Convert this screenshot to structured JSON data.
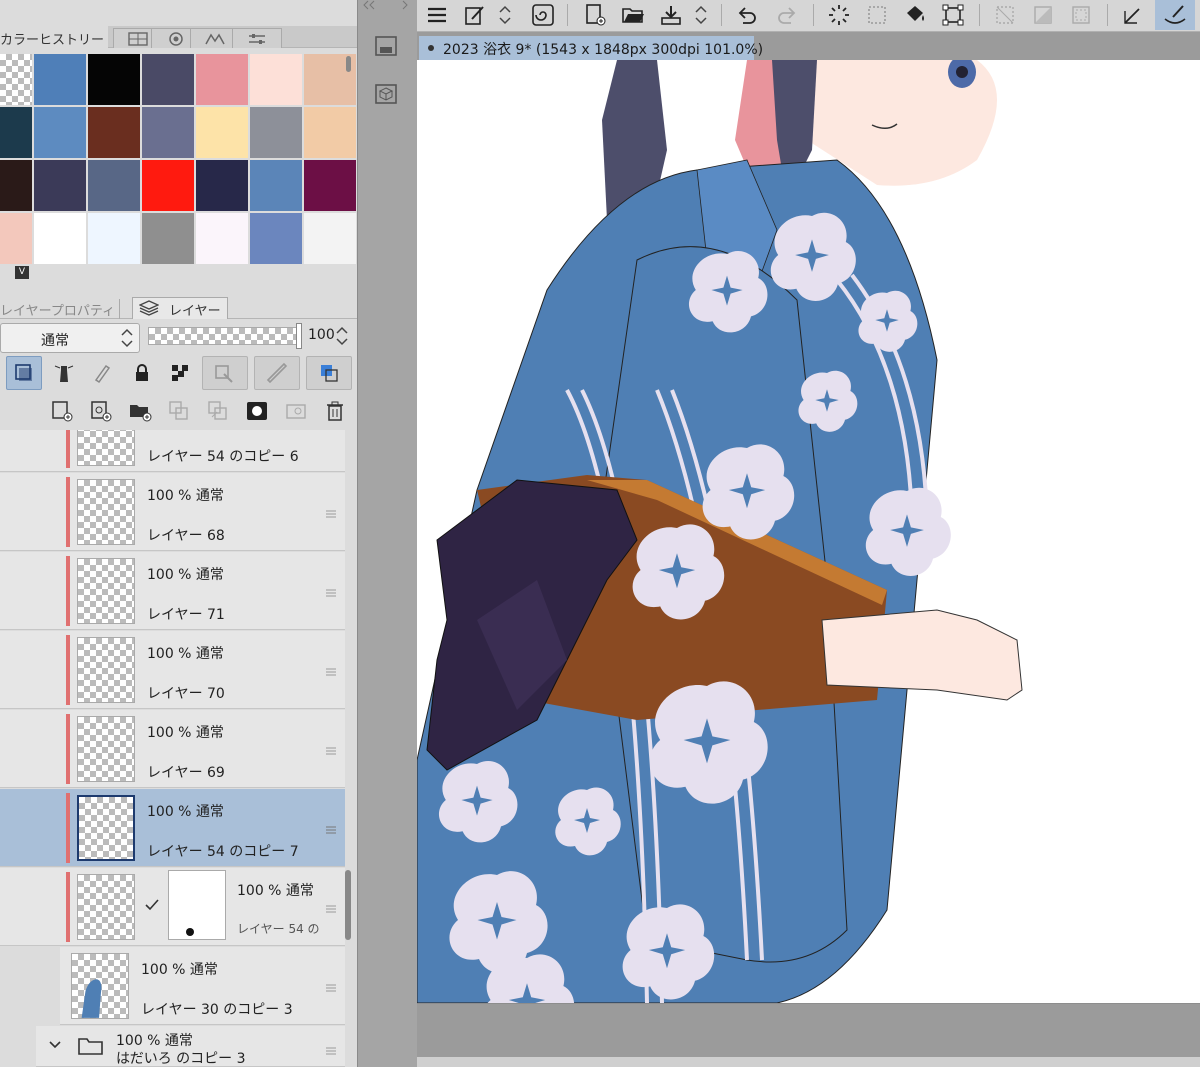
{
  "palette": {
    "tab_label": "カラーヒストリー",
    "tabs": [
      "color-set-icon",
      "color-circle-icon",
      "color-mountain-icon",
      "color-slider-icon"
    ],
    "swatches": [
      [
        "checker",
        "#4f7fb8",
        "#050505",
        "#4a4a66",
        "#e8949c",
        "#fde0d8",
        "#e7bfa6"
      ],
      [
        "#1c3a4c",
        "#5d8bc0",
        "#6a2e1f",
        "#6a6f90",
        "#fde3a8",
        "#8d9099",
        "#f2cba6"
      ],
      [
        "#2a1a18",
        "#3b3a58",
        "#586786",
        "#ff1a0f",
        "#272849",
        "#5b85b8",
        "#6c0f45"
      ],
      [
        "#f3c8bc",
        "#ffffff",
        "#eef6ff",
        "#8f8f8f",
        "#fbf5fb",
        "#6b86be",
        "#f3f3f3"
      ]
    ],
    "badge": "V"
  },
  "layer_panel": {
    "tab_property": "レイヤープロパティ",
    "tab_layer": "レイヤー",
    "blend_mode": "通常",
    "opacity": "100"
  },
  "layers": [
    {
      "name": "レイヤー 54 のコピー 6",
      "mode": "",
      "selected": false
    },
    {
      "name": "レイヤー 68",
      "mode": "100 % 通常",
      "selected": false
    },
    {
      "name": "レイヤー 71",
      "mode": "100 % 通常",
      "selected": false
    },
    {
      "name": "レイヤー 70",
      "mode": "100 % 通常",
      "selected": false
    },
    {
      "name": "レイヤー 69",
      "mode": "100 % 通常",
      "selected": false
    },
    {
      "name": "レイヤー 54 のコピー 7",
      "mode": "100 % 通常",
      "selected": true
    },
    {
      "name": "レイヤー 54 の",
      "mode": "100 % 通常",
      "selected": false,
      "mask": true
    },
    {
      "name": "レイヤー 30 のコピー 3",
      "mode": "100 % 通常",
      "selected": false
    },
    {
      "name": "はだいろ のコピー 3",
      "mode": "100 % 通常",
      "selected": false,
      "folder": true
    }
  ],
  "document": {
    "tab_title": "2023 浴衣 9* (1543 x 1848px 300dpi 101.0%)"
  },
  "colors": {
    "accent": "#a9bfd8",
    "layer_marker": "#e07070",
    "yukata_blue": "#4f7fb4",
    "flower": "#e6e0ef",
    "obi": "#2f2444",
    "obi_band": "#8a4a22"
  }
}
